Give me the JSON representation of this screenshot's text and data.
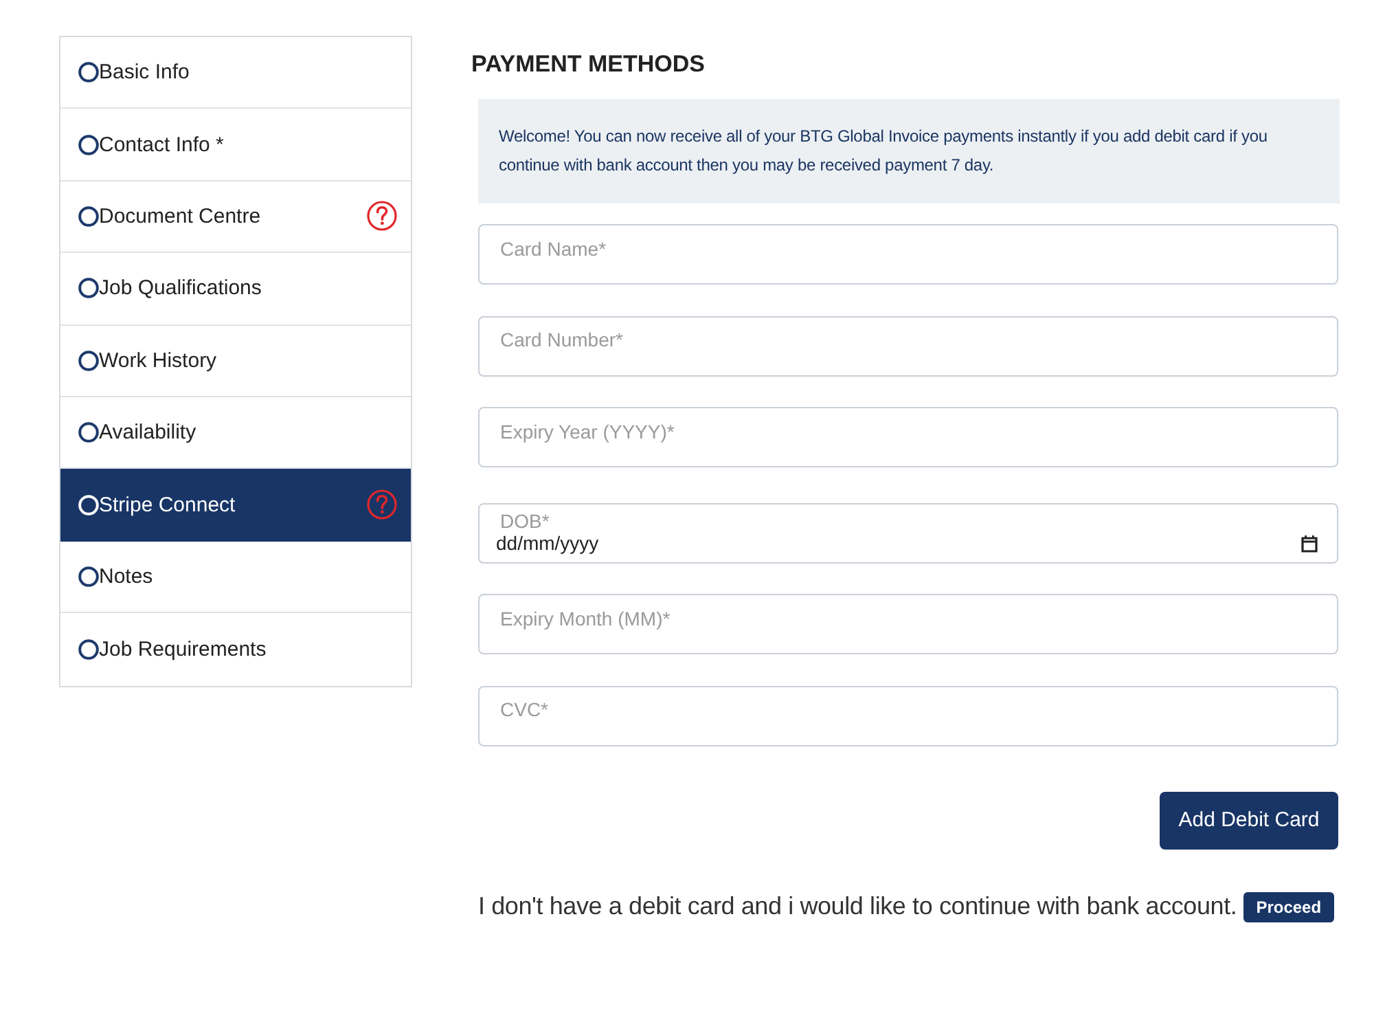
{
  "sidebar": {
    "items": [
      {
        "label": "Basic Info",
        "selected": false,
        "help": false
      },
      {
        "label": "Contact Info *",
        "selected": false,
        "help": false
      },
      {
        "label": "Document Centre",
        "selected": false,
        "help": true
      },
      {
        "label": "Job Qualifications",
        "selected": false,
        "help": false
      },
      {
        "label": "Work History",
        "selected": false,
        "help": false
      },
      {
        "label": "Availability",
        "selected": false,
        "help": false
      },
      {
        "label": "Stripe Connect",
        "selected": true,
        "help": true
      },
      {
        "label": "Notes",
        "selected": false,
        "help": false
      },
      {
        "label": "Job Requirements",
        "selected": false,
        "help": false
      }
    ]
  },
  "main": {
    "title": "PAYMENT METHODS",
    "notice": "Welcome! You can now receive all of your BTG Global Invoice payments instantly if you add debit card if you continue with bank account then you may be received payment 7 day.",
    "fields": [
      {
        "kind": "text",
        "placeholder": "Card Name*"
      },
      {
        "kind": "text",
        "placeholder": "Card Number*"
      },
      {
        "kind": "text",
        "placeholder": "Expiry Year (YYYY)*"
      },
      {
        "kind": "date",
        "label": "DOB*",
        "placeholder": "dd/mm/yyyy"
      },
      {
        "kind": "text",
        "placeholder": "Expiry Month (MM)*"
      },
      {
        "kind": "text",
        "placeholder": "CVC*"
      }
    ],
    "submit_button": "Add Debit Card",
    "bank_option": {
      "text": "I don't have a debit card and i would like to continue with bank account.",
      "button": "Proceed"
    }
  }
}
